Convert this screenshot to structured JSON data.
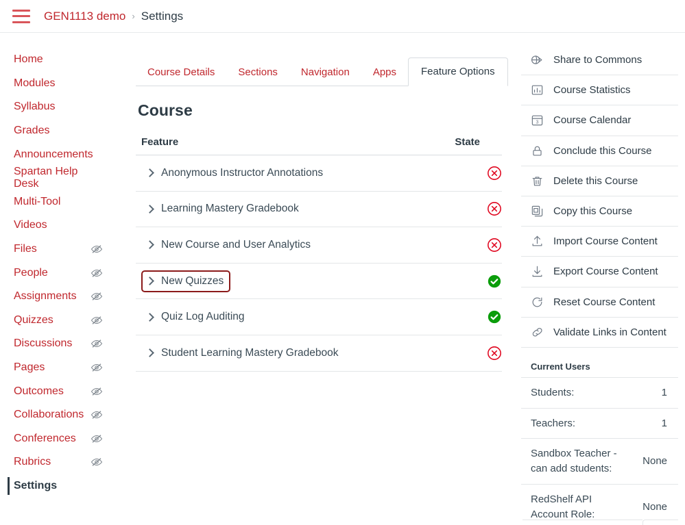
{
  "header": {
    "menu_icon": "hamburger-icon",
    "course_name": "GEN1113 demo",
    "separator": "›",
    "current_page": "Settings"
  },
  "colors": {
    "link_red": "#C0272D",
    "text_dark": "#2D3B45",
    "focus_red": "#8B1A1A",
    "state_on_green": "#0B9D0B",
    "state_off_red": "#E0061F",
    "border_grey": "#e3e6e8"
  },
  "course_nav": {
    "items": [
      {
        "label": "Home",
        "hidden": false,
        "active": false
      },
      {
        "label": "Modules",
        "hidden": false,
        "active": false
      },
      {
        "label": "Syllabus",
        "hidden": false,
        "active": false
      },
      {
        "label": "Grades",
        "hidden": false,
        "active": false
      },
      {
        "label": "Announcements",
        "hidden": false,
        "active": false
      },
      {
        "label": "Spartan Help Desk",
        "hidden": false,
        "active": false
      },
      {
        "label": "Multi-Tool",
        "hidden": false,
        "active": false
      },
      {
        "label": "Videos",
        "hidden": false,
        "active": false
      },
      {
        "label": "Files",
        "hidden": true,
        "active": false
      },
      {
        "label": "People",
        "hidden": true,
        "active": false
      },
      {
        "label": "Assignments",
        "hidden": true,
        "active": false
      },
      {
        "label": "Quizzes",
        "hidden": true,
        "active": false
      },
      {
        "label": "Discussions",
        "hidden": true,
        "active": false
      },
      {
        "label": "Pages",
        "hidden": true,
        "active": false
      },
      {
        "label": "Outcomes",
        "hidden": true,
        "active": false
      },
      {
        "label": "Collaborations",
        "hidden": true,
        "active": false
      },
      {
        "label": "Conferences",
        "hidden": true,
        "active": false
      },
      {
        "label": "Rubrics",
        "hidden": true,
        "active": false
      },
      {
        "label": "Settings",
        "hidden": false,
        "active": true
      }
    ],
    "hidden_icon": "eye-slash-icon"
  },
  "tabs": [
    {
      "label": "Course Details",
      "active": false
    },
    {
      "label": "Sections",
      "active": false
    },
    {
      "label": "Navigation",
      "active": false
    },
    {
      "label": "Apps",
      "active": false
    },
    {
      "label": "Feature Options",
      "active": true
    }
  ],
  "main": {
    "section_title": "Course",
    "table_headers": {
      "feature": "Feature",
      "state": "State"
    },
    "features": [
      {
        "name": "Anonymous Instructor Annotations",
        "state": "off",
        "state_icon": "circle-x-icon",
        "focused": false
      },
      {
        "name": "Learning Mastery Gradebook",
        "state": "off",
        "state_icon": "circle-x-icon",
        "focused": false
      },
      {
        "name": "New Course and User Analytics",
        "state": "off",
        "state_icon": "circle-x-icon",
        "focused": false
      },
      {
        "name": "New Quizzes",
        "state": "on",
        "state_icon": "circle-check-icon",
        "focused": true
      },
      {
        "name": "Quiz Log Auditing",
        "state": "on",
        "state_icon": "circle-check-icon",
        "focused": false
      },
      {
        "name": "Student Learning Mastery Gradebook",
        "state": "off",
        "state_icon": "circle-x-icon",
        "focused": false
      }
    ],
    "expand_icon": "chevron-right-icon"
  },
  "rightbar": {
    "buttons": [
      {
        "label": "Share to Commons",
        "icon": "commons-icon"
      },
      {
        "label": "Course Statistics",
        "icon": "bar-chart-icon"
      },
      {
        "label": "Course Calendar",
        "icon": "calendar-icon"
      },
      {
        "label": "Conclude this Course",
        "icon": "lock-icon"
      },
      {
        "label": "Delete this Course",
        "icon": "trash-icon"
      },
      {
        "label": "Copy this Course",
        "icon": "copy-icon"
      },
      {
        "label": "Import Course Content",
        "icon": "import-upload-icon"
      },
      {
        "label": "Export Course Content",
        "icon": "export-download-icon"
      },
      {
        "label": "Reset Course Content",
        "icon": "refresh-icon"
      },
      {
        "label": "Validate Links in Content",
        "icon": "link-icon"
      }
    ],
    "current_users": {
      "heading": "Current Users",
      "rows": [
        {
          "label": "Students:",
          "value": "1"
        },
        {
          "label": "Teachers:",
          "value": "1"
        },
        {
          "label": "Sandbox Teacher - can add students:",
          "value": "None"
        },
        {
          "label": "RedShelf API Account Role:",
          "value": "None"
        }
      ]
    }
  }
}
